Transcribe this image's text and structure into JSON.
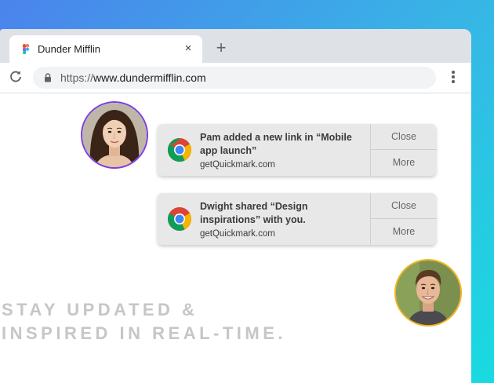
{
  "colors": {
    "gradient_start": "#4b83ec",
    "gradient_end": "#18dbe0",
    "avatar_ring_1": "#7b3fe4",
    "avatar_ring_2": "#f0b41c",
    "tagline": "#c6c6c6"
  },
  "browser": {
    "tab": {
      "title": "Dunder Mifflin",
      "favicon": "figma-icon",
      "close": "×"
    },
    "new_tab": "+",
    "address": {
      "scheme": "https://",
      "host": "www.dundermifflin.com"
    }
  },
  "notifications": [
    {
      "icon": "chrome-icon",
      "message": "Pam added a new link in “Mobile app launch”",
      "source": "getQuickmark.com",
      "actions": [
        "Close",
        "More"
      ]
    },
    {
      "icon": "chrome-icon",
      "message": "Dwight shared “Design inspirations” with you.",
      "source": "getQuickmark.com",
      "actions": [
        "Close",
        "More"
      ]
    }
  ],
  "tagline": {
    "line1": "STAY UPDATED &",
    "line2": "INSPIRED IN REAL-TIME."
  }
}
